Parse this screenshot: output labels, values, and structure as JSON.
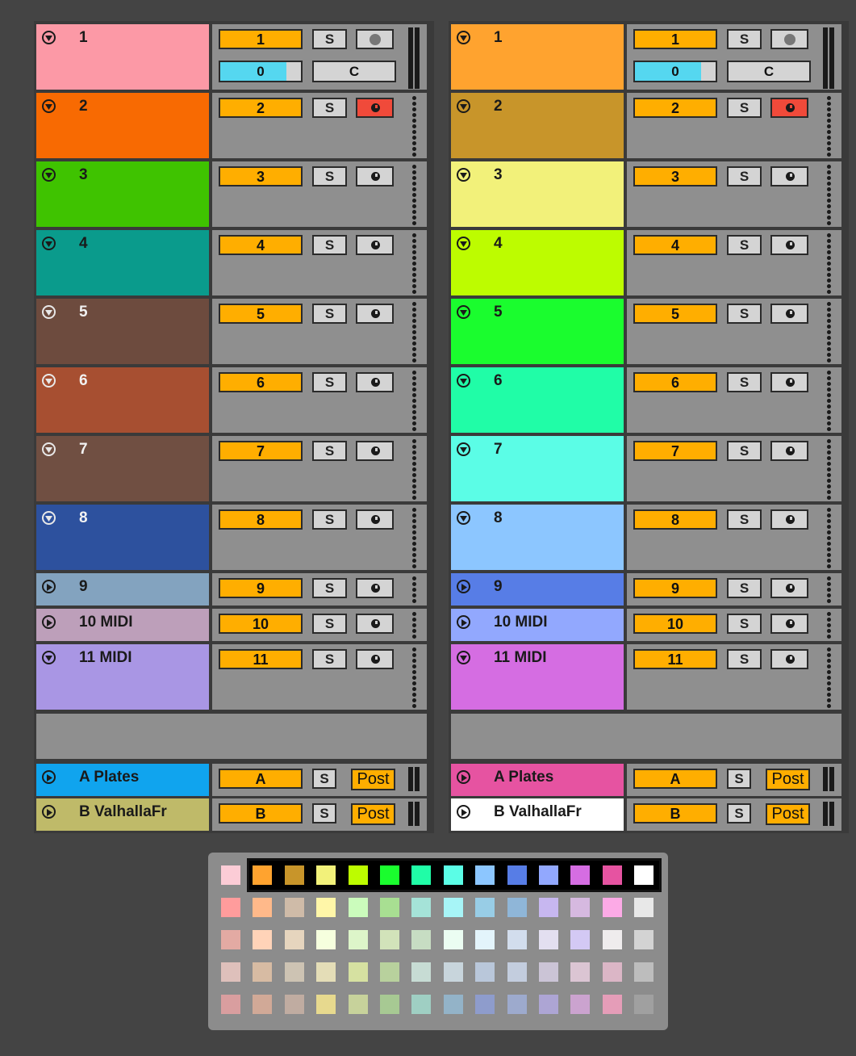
{
  "panels": [
    {
      "tracks": [
        {
          "name": "1",
          "number": "1",
          "color": "#fc99a6",
          "solo": "S",
          "monitor": "record",
          "dark_text": false,
          "send": "0",
          "crossfade": "C"
        },
        {
          "name": "2",
          "number": "2",
          "color": "#f86a02",
          "solo": "S",
          "monitor": "clock-red",
          "dark_text": false
        },
        {
          "name": "3",
          "number": "3",
          "color": "#3fc300",
          "solo": "S",
          "monitor": "clock",
          "dark_text": false
        },
        {
          "name": "4",
          "number": "4",
          "color": "#0a9b8c",
          "solo": "S",
          "monitor": "clock",
          "dark_text": false
        },
        {
          "name": "5",
          "number": "5",
          "color": "#6d4b3e",
          "solo": "S",
          "monitor": "clock",
          "dark_text": true
        },
        {
          "name": "6",
          "number": "6",
          "color": "#a74f31",
          "solo": "S",
          "monitor": "clock",
          "dark_text": true
        },
        {
          "name": "7",
          "number": "7",
          "color": "#704f42",
          "solo": "S",
          "monitor": "clock",
          "dark_text": true
        },
        {
          "name": "8",
          "number": "8",
          "color": "#2d519e",
          "solo": "S",
          "monitor": "clock",
          "dark_text": true
        },
        {
          "name": "9",
          "number": "9",
          "color": "#83a3bf",
          "solo": "S",
          "monitor": "clock",
          "dark_text": false
        },
        {
          "name": "10 MIDI",
          "number": "10",
          "color": "#bd9fba",
          "solo": "S",
          "monitor": "clock",
          "dark_text": false
        },
        {
          "name": "11 MIDI",
          "number": "11",
          "color": "#a996e4",
          "solo": "S",
          "monitor": "clock",
          "dark_text": false
        }
      ],
      "returns": [
        {
          "name": "A Plates",
          "letter": "A",
          "color": "#10a4ee",
          "solo": "S",
          "post": "Post"
        },
        {
          "name": "B ValhallaFr",
          "letter": "B",
          "color": "#bfba69",
          "solo": "S",
          "post": "Post"
        }
      ]
    },
    {
      "tracks": [
        {
          "name": "1",
          "number": "1",
          "color": "#ffa32f",
          "solo": "S",
          "monitor": "record",
          "dark_text": false,
          "send": "0",
          "crossfade": "C"
        },
        {
          "name": "2",
          "number": "2",
          "color": "#c8952a",
          "solo": "S",
          "monitor": "clock-red",
          "dark_text": false
        },
        {
          "name": "3",
          "number": "3",
          "color": "#f2f17a",
          "solo": "S",
          "monitor": "clock",
          "dark_text": false
        },
        {
          "name": "4",
          "number": "4",
          "color": "#bdfc00",
          "solo": "S",
          "monitor": "clock",
          "dark_text": false
        },
        {
          "name": "5",
          "number": "5",
          "color": "#1afd2e",
          "solo": "S",
          "monitor": "clock",
          "dark_text": false
        },
        {
          "name": "6",
          "number": "6",
          "color": "#20fda7",
          "solo": "S",
          "monitor": "clock",
          "dark_text": false
        },
        {
          "name": "7",
          "number": "7",
          "color": "#5bfde6",
          "solo": "S",
          "monitor": "clock",
          "dark_text": false
        },
        {
          "name": "8",
          "number": "8",
          "color": "#8cc6ff",
          "solo": "S",
          "monitor": "clock",
          "dark_text": false
        },
        {
          "name": "9",
          "number": "9",
          "color": "#577de6",
          "solo": "S",
          "monitor": "clock",
          "dark_text": false
        },
        {
          "name": "10 MIDI",
          "number": "10",
          "color": "#92a8fe",
          "solo": "S",
          "monitor": "clock",
          "dark_text": false
        },
        {
          "name": "11 MIDI",
          "number": "11",
          "color": "#d56de2",
          "solo": "S",
          "monitor": "clock",
          "dark_text": false
        }
      ],
      "returns": [
        {
          "name": "A Plates",
          "letter": "A",
          "color": "#e653a1",
          "solo": "S",
          "post": "Post"
        },
        {
          "name": "B ValhallaFr",
          "letter": "B",
          "color": "#ffffff",
          "solo": "S",
          "post": "Post"
        }
      ]
    }
  ],
  "palette": {
    "rows": [
      [
        "#fcccd6",
        "#ffa32f",
        "#c8952a",
        "#f2f17a",
        "#bdfc00",
        "#1afd2e",
        "#20fda7",
        "#5bfde6",
        "#8cc6ff",
        "#577de6",
        "#92a8fe",
        "#d56de2",
        "#e653a1",
        "#ffffff"
      ],
      [
        "#ff9c9c",
        "#ffb98a",
        "#cfbba8",
        "#fff6a8",
        "#cbfcbc",
        "#a8df92",
        "#a5e3d8",
        "#a7f5f7",
        "#98cde6",
        "#8fb6d8",
        "#c7b7f0",
        "#d6b9e0",
        "#fcaae6",
        "#e8e8e8"
      ],
      [
        "#e3aaa3",
        "#ffd3b8",
        "#e6d5be",
        "#f6ffde",
        "#ddf5c9",
        "#d2e3ba",
        "#c7ddc3",
        "#ebfdf2",
        "#e3f4fb",
        "#d2dded",
        "#e3dff0",
        "#d3c9f4",
        "#efeced",
        "#d3d3d3"
      ],
      [
        "#dec0bb",
        "#d7bba3",
        "#cdc3b3",
        "#e4ddb7",
        "#d6e1a1",
        "#b8d19d",
        "#c7dcd4",
        "#c8d5dc",
        "#b9c7da",
        "#c3cdde",
        "#cbc4d6",
        "#dbc5d3",
        "#dbb6c6",
        "#bdbdbd"
      ],
      [
        "#d99e9f",
        "#d1a997",
        "#c0aca1",
        "#e7d98e",
        "#c7d29b",
        "#a7c993",
        "#9fcfc3",
        "#93b3c8",
        "#8e9ccc",
        "#9daacd",
        "#ada5d4",
        "#cba3cf",
        "#e59db8",
        "#a0a0a0"
      ]
    ],
    "selected_row": 0
  }
}
